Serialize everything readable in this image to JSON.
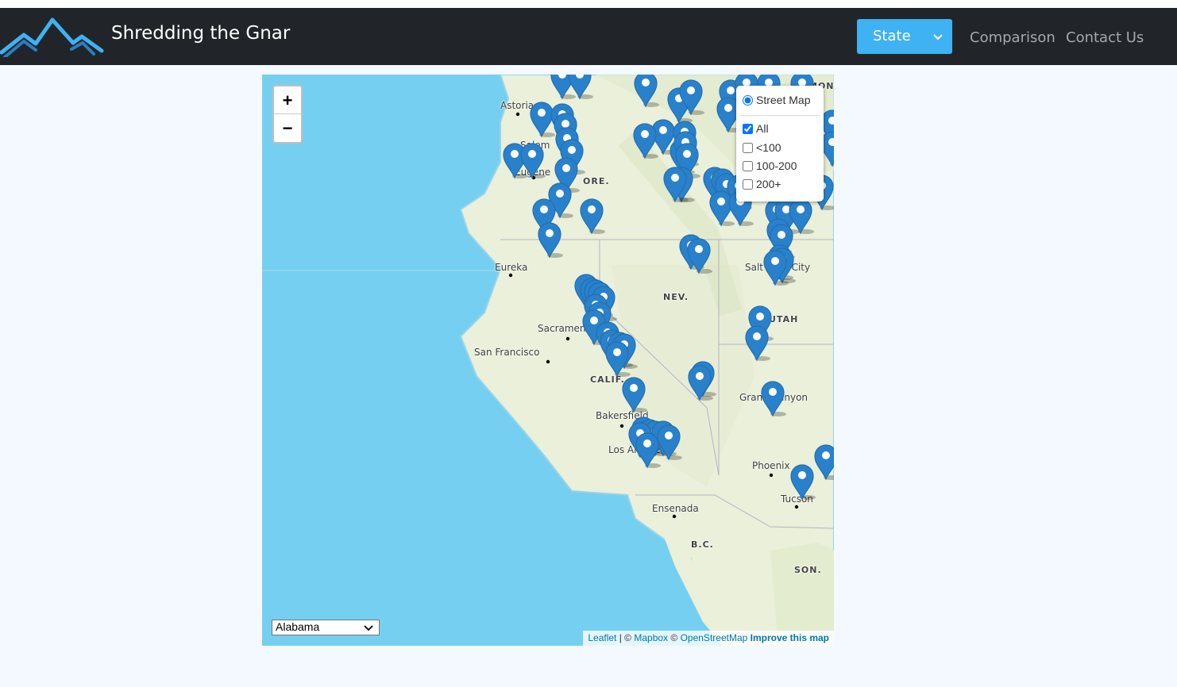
{
  "navbar": {
    "brand": "Shredding the Gnar",
    "state_button": "State",
    "links": [
      "Comparison",
      "Contact Us"
    ]
  },
  "map": {
    "zoom_in": "+",
    "zoom_out": "−",
    "layers": {
      "base": "Street Map",
      "overlays": [
        {
          "label": "All",
          "checked": true
        },
        {
          "label": "<100",
          "checked": false
        },
        {
          "label": "100-200",
          "checked": false
        },
        {
          "label": "200+",
          "checked": false
        }
      ]
    },
    "labels": {
      "astoria": "Astoria",
      "salem": "Salem",
      "eugene": "Eugene",
      "ore": "ORE.",
      "eureka": "Eureka",
      "nev": "NEV.",
      "sacramento": "Sacramento",
      "san_francisco": "San Francisco",
      "calif": "CALIF.",
      "bakersfield": "Bakersfield",
      "los_angeles": "Los Angeles",
      "ensenada": "Ensenada",
      "bc": "B.C.",
      "salt_lake": "Salt Lake City",
      "utah": "UTAH",
      "grand_canyon": "Grand Canyon",
      "phoenix": "Phoenix",
      "tucson": "Tucson",
      "son": "SON.",
      "mont": "MON"
    },
    "state_select": "Alabama",
    "attribution": {
      "leaflet": "Leaflet",
      "sep1": " | © ",
      "mapbox": "Mapbox",
      "sep2": " © ",
      "osm": "OpenStreetMap",
      "improve": "Improve this map"
    },
    "marker_color": "#2a81cb"
  }
}
